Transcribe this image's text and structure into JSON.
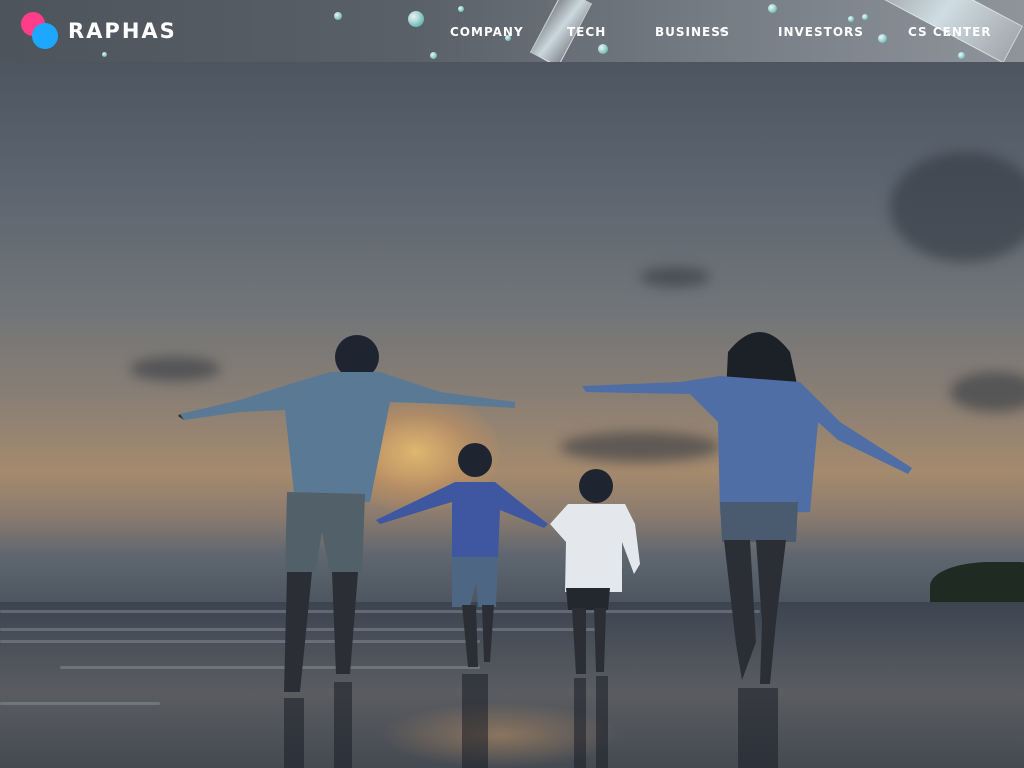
{
  "brand": {
    "name": "RAPHAS",
    "colors": {
      "pink": "#ff3d8b",
      "blue": "#1ea7ff",
      "purple": "#7a2cd6"
    }
  },
  "nav": {
    "items": [
      {
        "label": "COMPANY"
      },
      {
        "label": "TECH"
      },
      {
        "label": "BUSINESS"
      },
      {
        "label": "INVESTORS"
      },
      {
        "label": "CS CENTER"
      }
    ]
  },
  "hero": {
    "image_subject": "family-on-beach-at-sunset"
  }
}
